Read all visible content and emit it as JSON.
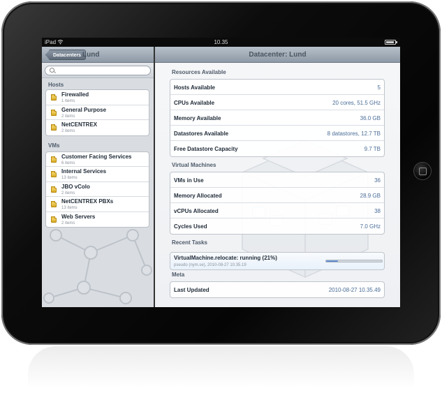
{
  "statusbar": {
    "carrier": "iPad",
    "time": "10.35"
  },
  "left": {
    "back_label": "Datacenters",
    "title": "Lund",
    "search_placeholder": "",
    "sections": [
      {
        "title": "Hosts",
        "items": [
          {
            "name": "Firewalled",
            "count": "1 items"
          },
          {
            "name": "General Purpose",
            "count": "2 items"
          },
          {
            "name": "NetCENTREX",
            "count": "2 items"
          }
        ]
      },
      {
        "title": "VMs",
        "items": [
          {
            "name": "Customer Facing Services",
            "count": "6 items"
          },
          {
            "name": "Internal Services",
            "count": "13 items"
          },
          {
            "name": "JBO vColo",
            "count": "2 items"
          },
          {
            "name": "NetCENTREX PBXs",
            "count": "13 items"
          },
          {
            "name": "Web Servers",
            "count": "2 items"
          }
        ]
      }
    ]
  },
  "right": {
    "title": "Datacenter: Lund",
    "resources": {
      "title": "Resources Available",
      "rows": [
        {
          "label": "Hosts Available",
          "value": "5"
        },
        {
          "label": "CPUs Available",
          "value": "20 cores, 51.5 GHz"
        },
        {
          "label": "Memory Available",
          "value": "36.0 GB"
        },
        {
          "label": "Datastores Available",
          "value": "8 datastores, 12.7 TB"
        },
        {
          "label": "Free Datastore Capacity",
          "value": "9.7 TB"
        }
      ]
    },
    "vms": {
      "title": "Virtual Machines",
      "rows": [
        {
          "label": "VMs in Use",
          "value": "36"
        },
        {
          "label": "Memory Allocated",
          "value": "28.9 GB"
        },
        {
          "label": "vCPUs Allocated",
          "value": "38"
        },
        {
          "label": "Cycles Used",
          "value": "7.0 GHz"
        }
      ]
    },
    "tasks": {
      "title": "Recent Tasks",
      "task": "VirtualMachine.relocate: running (21%)",
      "sub": "pseudo (nym.se), 2010-08-27 10.35.19",
      "progress": 0.21
    },
    "meta": {
      "title": "Meta",
      "rows": [
        {
          "label": "Last Updated",
          "value": "2010-08-27 10.35.49"
        }
      ]
    }
  },
  "colors": {
    "accent_value": "#4a6d97",
    "progress_fill": "#3b73c4"
  }
}
